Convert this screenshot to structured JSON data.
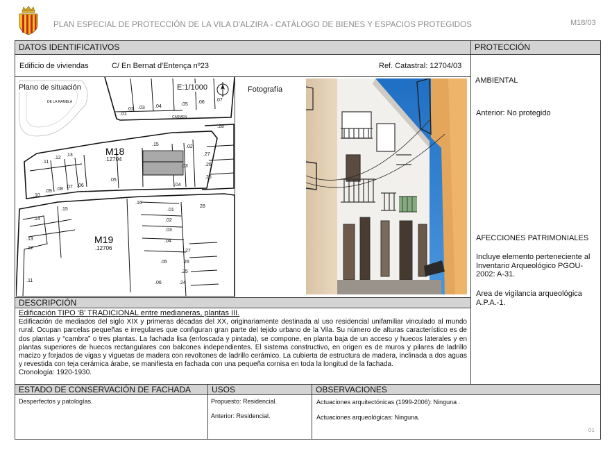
{
  "header": {
    "title": "PLAN ESPECIAL DE PROTECCIÓN DE LA VILA D'ALZIRA - CATÁLOGO DE BIENES Y ESPACIOS PROTEGIDOS",
    "code": "M18/03"
  },
  "identificativos": {
    "section_title": "DATOS IDENTIFICATIVOS",
    "type": "Edificio de viviendas",
    "address": "C/ En Bernat d'Entença nº23",
    "ref": "Ref. Catastral: 12704/03"
  },
  "plano": {
    "label": "Plano de situación",
    "scale": "E:1/1000",
    "north": "N",
    "block1": "M18",
    "block1_ref": ".12704",
    "block2": "M19",
    "block2_ref": ".12706",
    "street1": "DE LA RAMBLA",
    "street2": "CARMEN"
  },
  "foto": {
    "label": "Fotografía"
  },
  "proteccion": {
    "section_title": "PROTECCIÓN",
    "level": "AMBIENTAL",
    "anterior": "Anterior: No protegido",
    "afecciones_title": "AFECCIONES PATRIMONIALES",
    "afecciones_1": "Incluye elemento perteneciente al Inventario Arqueológico PGOU-2002: A-31.",
    "afecciones_2": "Area de vigilancia arqueológica A.P.A.-1."
  },
  "descripcion": {
    "section_title": "DESCRIPCIÓN",
    "subtitle": "Edificación TIPO 'B' TRADICIONAL entre medianeras, plantas III.",
    "body": "Edificación de mediados del siglo XIX y primeras décadas del XX, originariamente destinada al uso residencial unifamiliar vinculado al mundo rural. Ocupan parcelas pequeñas e irregulares que configuran gran parte del tejido urbano de la Vila. Su número de alturas característico es de dos plantas y “cambra” o tres plantas. La fachada lisa (enfoscada y pintada), se compone, en planta baja de un acceso y huecos laterales y en plantas superiores de huecos rectangulares con balcones independientes. El sistema constructivo, en origen es de muros y pilares de ladrillo macizo y forjados de vigas y viguetas de madera con revoltones de ladrillo cerámico. La cubierta de estructura de madera, inclinada a dos aguas y revestida con teja cerámica árabe, se manifiesta en fachada con una pequeña cornisa en toda la longitud de la fachada.",
    "cronologia": "Cronología: 1920-1930."
  },
  "estado": {
    "section_title": "ESTADO DE CONSERVACIÓN DE FACHADA",
    "text": "Desperfectos y patologías."
  },
  "usos": {
    "section_title": "USOS",
    "propuesto": "Propuesto: Residencial.",
    "anterior": "Anterior: Residencial."
  },
  "observaciones": {
    "section_title": "OBSERVACIONES",
    "line1": "Actuaciones arquitectónicas (1999-2006): Ninguna .",
    "line2": "Actuaciones arqueológicas: Ninguna."
  },
  "footer": {
    "page": "01"
  },
  "colors": {
    "bar": "#d4d4d4",
    "border": "#444444",
    "header_text": "#8c8c8c",
    "highlight_parcel": "#a9a9a9"
  },
  "icons": [
    "coat-of-arms-icon",
    "north-arrow-icon"
  ]
}
